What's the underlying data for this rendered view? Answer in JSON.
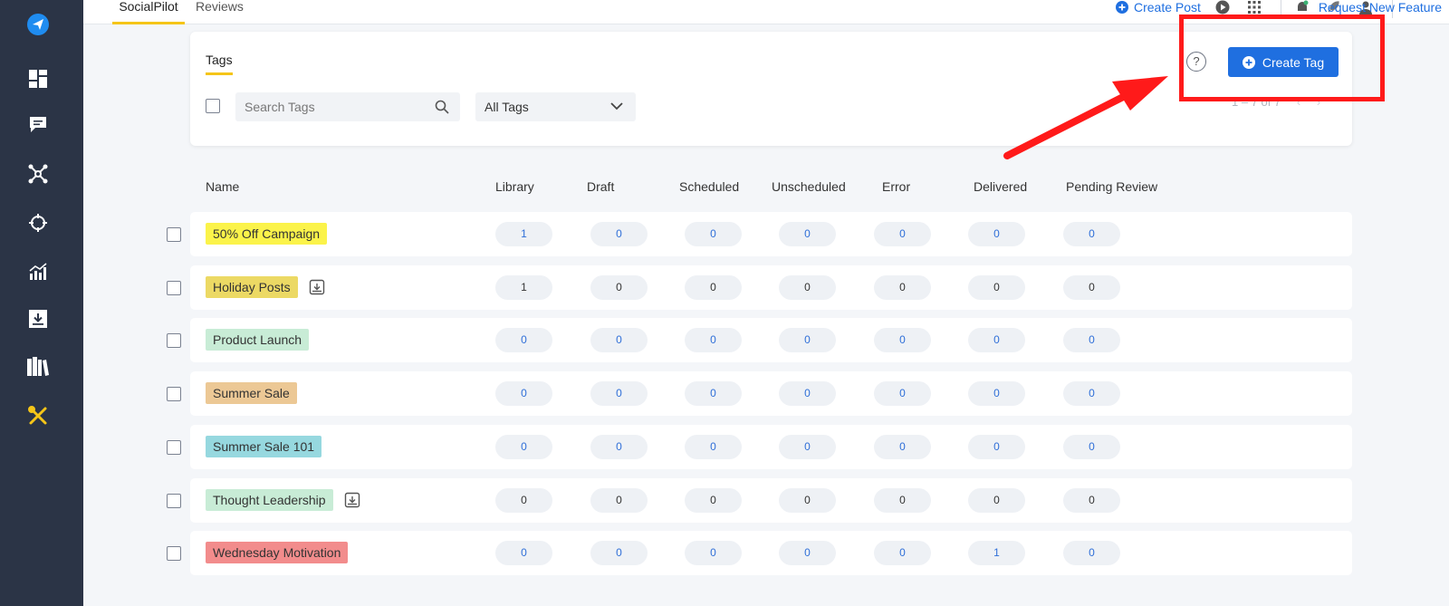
{
  "colors": {
    "sidebar_bg": "#2b3446",
    "accent_blue": "#1f6fe0",
    "active_underline": "#f5c518",
    "highlight_red": "#ff1a1a"
  },
  "sidebar": {
    "items": [
      {
        "icon": "send-logo-icon"
      },
      {
        "icon": "dashboard-icon"
      },
      {
        "icon": "chat-icon"
      },
      {
        "icon": "network-icon"
      },
      {
        "icon": "crosshair-icon"
      },
      {
        "icon": "analytics-icon"
      },
      {
        "icon": "inbox-download-icon"
      },
      {
        "icon": "library-icon"
      },
      {
        "icon": "tools-icon"
      }
    ]
  },
  "topnav": {
    "tabs": [
      "SocialPilot",
      "Reviews"
    ],
    "create_post": "Create Post",
    "request_feature": "Request New Feature"
  },
  "card": {
    "tab": "Tags",
    "search_placeholder": "Search Tags",
    "filter_value": "All Tags",
    "help": "?",
    "create_tag": "Create Tag",
    "pager": "1 – 7 of 7"
  },
  "table": {
    "headers": [
      "Name",
      "Library",
      "Draft",
      "Scheduled",
      "Unscheduled",
      "Error",
      "Delivered",
      "Pending Review"
    ],
    "rows": [
      {
        "name": "50% Off Campaign",
        "color": "#fbf34a",
        "archived": false,
        "values": [
          "1",
          "0",
          "0",
          "0",
          "0",
          "0",
          "0"
        ],
        "value_color": "blue"
      },
      {
        "name": "Holiday Posts",
        "color": "#ecd964",
        "archived": true,
        "values": [
          "1",
          "0",
          "0",
          "0",
          "0",
          "0",
          "0"
        ],
        "value_color": "dark"
      },
      {
        "name": "Product Launch",
        "color": "#c8ecd6",
        "archived": false,
        "values": [
          "0",
          "0",
          "0",
          "0",
          "0",
          "0",
          "0"
        ],
        "value_color": "blue"
      },
      {
        "name": "Summer Sale",
        "color": "#ecc895",
        "archived": false,
        "values": [
          "0",
          "0",
          "0",
          "0",
          "0",
          "0",
          "0"
        ],
        "value_color": "blue"
      },
      {
        "name": "Summer Sale 101",
        "color": "#96d8df",
        "archived": false,
        "values": [
          "0",
          "0",
          "0",
          "0",
          "0",
          "0",
          "0"
        ],
        "value_color": "blue"
      },
      {
        "name": "Thought Leadership",
        "color": "#c8ecd6",
        "archived": true,
        "values": [
          "0",
          "0",
          "0",
          "0",
          "0",
          "0",
          "0"
        ],
        "value_color": "dark"
      },
      {
        "name": "Wednesday Motivation",
        "color": "#f28c8c",
        "archived": false,
        "values": [
          "0",
          "0",
          "0",
          "0",
          "0",
          "1",
          "0"
        ],
        "value_color": "blue"
      }
    ]
  }
}
